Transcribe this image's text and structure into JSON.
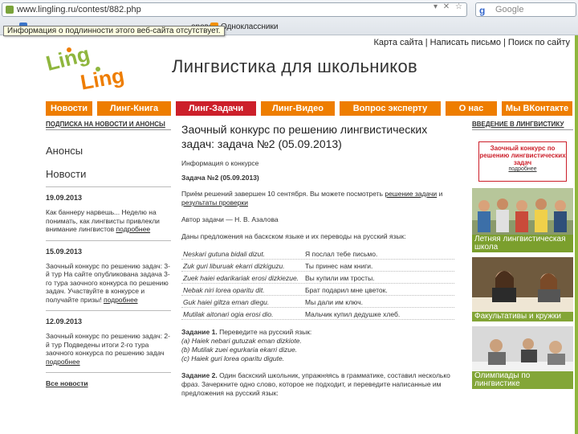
{
  "browser": {
    "url": "www.lingling.ru/contest/882.php",
    "search_placeholder": "Google",
    "search_engine_icon": "google-g-icon",
    "bookmarks": [
      {
        "label": "ороват",
        "icon_color": "#3a74c9"
      },
      {
        "label": "Одноклассники",
        "icon_color": "#f29100"
      }
    ],
    "tooltip": "Информация о подлинности этого веб-сайта отсутствует."
  },
  "page": {
    "top_links": [
      "Карта сайта",
      "Написать письмо",
      "Поиск по сайту"
    ],
    "logo": {
      "word1": "Ling",
      "word2": "Ling"
    },
    "site_title": "Лингвистика для школьников",
    "nav": [
      {
        "label": "Новости",
        "active": false
      },
      {
        "label": "Линг-Книга",
        "active": false
      },
      {
        "label": "Линг-Задачи",
        "active": true
      },
      {
        "label": "Линг-Видео",
        "active": false
      },
      {
        "label": "Вопрос эксперту",
        "active": false
      },
      {
        "label": "О нас",
        "active": false
      },
      {
        "label": "Мы ВКонтакте",
        "active": false
      }
    ],
    "colors": {
      "nav": "#ee7d00",
      "nav_active": "#cc1f2a",
      "caption": "#7aa028",
      "promo_border": "#cc1f2a"
    }
  },
  "left": {
    "subscribe": "ПОДПИСКА НА НОВОСТИ И АНОНСЫ",
    "announcements": "Анонсы",
    "news": "Новости",
    "items": [
      {
        "date": "19.09.2013",
        "text": "Как баннеру нарвешь... Неделю на понимать, как лингвисты привлекли внимание лингвистов",
        "more": "подробнее"
      },
      {
        "date": "15.09.2013",
        "text": "Заочный конкурс по решению задач: 3-й тур На сайте опубликована задача 3-го тура заочного конкурса по решению задач. Участвуйте в конкурсе и получайте призы!",
        "more": "подробнее"
      },
      {
        "date": "12.09.2013",
        "text": "Заочный конкурс по решению задач: 2-й тур Подведены итоги 2-го тура заочного конкурса по решению задач",
        "more": "подробнее"
      }
    ],
    "all_news": "Все новости"
  },
  "center": {
    "title": "Заочный конкурс по решению лингвистических задач: задача №2 (05.09.2013)",
    "info_link": "Информация о конкурсе",
    "task_label": "Задача №2 (05.09.2013)",
    "intro_before": "Приём решений завершен 10 сентября. Вы можете посмотреть",
    "intro_link1": "решение задачи",
    "intro_mid": "и",
    "intro_link2": "результаты проверки",
    "author": "Автор задачи — Н. В. Азалова",
    "lead": "Даны предложения на баскском языке и их переводы на русский язык:",
    "pairs": [
      {
        "src": "Neskari gutuna bidali dizut.",
        "dst": "Я послал тебе письмо."
      },
      {
        "src": "Zuk guri liburuak ekarri dizkiguzu.",
        "dst": "Ты принес нам книги."
      },
      {
        "src": "Zuek haiei edarikariak erosi dizkiezue.",
        "dst": "Вы купили им тросты."
      },
      {
        "src": "Nebak niri lorea oparitu dit.",
        "dst": "Брат подарил мне цветок."
      },
      {
        "src": "Guk haiei giltza eman diegu.",
        "dst": "Мы дали им ключ."
      },
      {
        "src": "Mutilak aitonari ogia erosi dio.",
        "dst": "Мальчик купил дедушке хлеб."
      }
    ],
    "task1_title": "Задание 1.",
    "task1_text": "Переведите на русский язык:",
    "task1_items": [
      "(a) Haiek nebari gutuzak eman dizkiote.",
      "(b) Mutilak zuei egurkaria ekarri dizue.",
      "(c) Haiek guri lorea oparitu digute."
    ],
    "task2_title": "Задание 2.",
    "task2_text": "Один баскский школьник, упражняясь в грамматике, составил несколько фраз. Зачеркните одно слово, которое не подходит, и переведите написанные им предложения на русский язык:"
  },
  "right": {
    "intro": "ВВЕДЕНИЕ В ЛИНГВИСТИКУ",
    "promo_text": "Заочный конкурс по решению лингвистических задач",
    "promo_more": "подробнее",
    "photos": [
      {
        "caption": "Летняя лингвистическая школа"
      },
      {
        "caption": "Факультативы и кружки"
      },
      {
        "caption": "Олимпиады по лингвистике"
      }
    ]
  }
}
